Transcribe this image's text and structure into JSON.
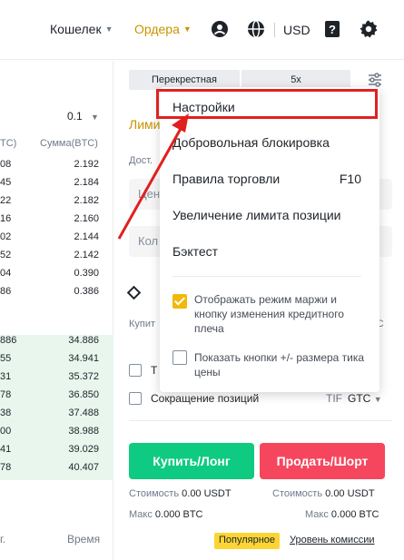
{
  "nav": {
    "wallet": "Кошелек",
    "orders": "Ордера",
    "currency": "USD",
    "orders_color": "#c99400"
  },
  "orderbook": {
    "precision": "0.1",
    "col_left": "ТС)",
    "col_right": "Сумма(BTC)",
    "asks": [
      {
        "l": "08",
        "r": "2.192"
      },
      {
        "l": "45",
        "r": "2.184"
      },
      {
        "l": "22",
        "r": "2.182"
      },
      {
        "l": "16",
        "r": "2.160"
      },
      {
        "l": "02",
        "r": "2.144"
      },
      {
        "l": "52",
        "r": "2.142"
      },
      {
        "l": "04",
        "r": "0.390"
      },
      {
        "l": "86",
        "r": "0.386"
      }
    ],
    "bids": [
      {
        "l": "886",
        "r": "34.886"
      },
      {
        "l": "55",
        "r": "34.941"
      },
      {
        "l": "31",
        "r": "35.372"
      },
      {
        "l": "78",
        "r": "36.850"
      },
      {
        "l": "38",
        "r": "37.488"
      },
      {
        "l": "00",
        "r": "38.988"
      },
      {
        "l": "41",
        "r": "39.029"
      },
      {
        "l": "78",
        "r": "40.407"
      }
    ],
    "bottom_left": "г.",
    "bottom_right": "Время"
  },
  "form": {
    "margin_mode": "Перекрестная",
    "leverage": "5x",
    "order_type": "Лими",
    "available": "Дост.",
    "price_placeholder": "Цен",
    "qty_placeholder": "Кол",
    "buy_label": "Купит",
    "gtc_top": "TC",
    "tp_label": "Т",
    "reduce_only": "Сокращение позиций",
    "tif_label": "TIF",
    "tif_value": "GTC",
    "buy_button": "Купить/Лонг",
    "sell_button": "Продать/Шорт",
    "cost_left_label": "Стоимость",
    "cost_left_value": "0.00 USDT",
    "cost_right_label": "Стоимость",
    "cost_right_value": "0.00 USDT",
    "max_left_label": "Макс",
    "max_left_value": "0.000 BTC",
    "max_right_label": "Макс",
    "max_right_value": "0.000 BTC",
    "popular_badge": "Популярное",
    "fee_link": "Уровень комиссии",
    "buy_color": "#0ecb81",
    "sell_color": "#f6465d"
  },
  "menu": {
    "items": [
      "Настройки",
      "Добровольная блокировка",
      "Правила торговли",
      "Увеличение лимита позиции",
      "Бэктест"
    ],
    "rules_shortcut": "F10",
    "checkbox1_label": "Отображать режим маржи и кнопку изменения кредитного плеча",
    "checkbox1_checked": true,
    "checkbox2_label": "Показать кнопки +/- размера тика цены",
    "checkbox2_checked": false,
    "highlight_color": "#e0201f"
  }
}
